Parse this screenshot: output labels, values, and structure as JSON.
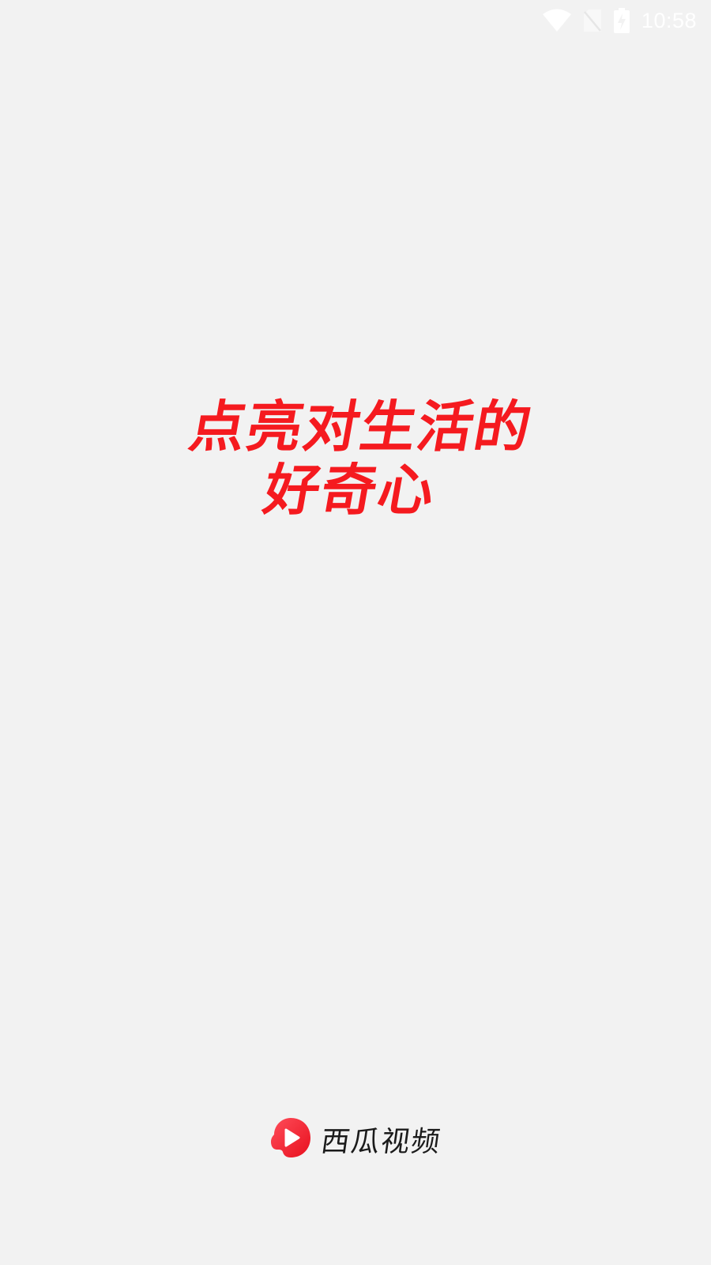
{
  "status_bar": {
    "time": "10:58",
    "icons": [
      "wifi-icon",
      "no-sim-icon",
      "battery-charging-icon"
    ],
    "icon_color": "#ffffff"
  },
  "splash": {
    "slogan_line_1": "点亮对生活的",
    "slogan_line_2": "好奇心",
    "slogan_color": "#f51a1f"
  },
  "brand": {
    "name": "西瓜视频",
    "logo_icon": "xigua-play-logo-icon",
    "logo_color": "#f5222d"
  }
}
